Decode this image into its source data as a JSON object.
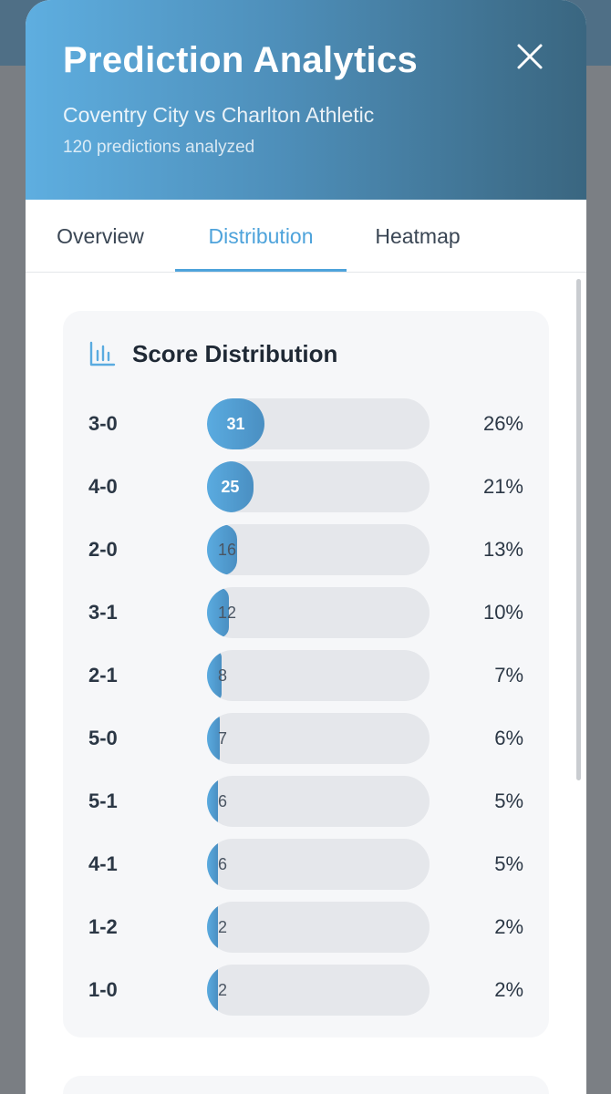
{
  "header": {
    "title": "Prediction Analytics",
    "subtitle": "Coventry City vs Charlton Athletic",
    "meta": "120 predictions analyzed",
    "close_icon": "close-icon"
  },
  "tabs": [
    {
      "label": "Overview",
      "active": false
    },
    {
      "label": "Distribution",
      "active": true
    },
    {
      "label": "Heatmap",
      "active": false
    }
  ],
  "card": {
    "icon": "bar-chart-icon",
    "title": "Score Distribution"
  },
  "colors": {
    "accent": "#4ea3db",
    "header_start": "#5eaee0",
    "header_end": "#3a6680",
    "track": "#e5e7eb"
  },
  "chart_data": {
    "type": "bar",
    "categories": [
      "3-0",
      "4-0",
      "2-0",
      "3-1",
      "2-1",
      "5-0",
      "5-1",
      "4-1",
      "1-2",
      "1-0"
    ],
    "values": [
      31,
      25,
      16,
      12,
      8,
      7,
      6,
      6,
      2,
      2
    ],
    "percentages": [
      "26%",
      "21%",
      "13%",
      "10%",
      "7%",
      "6%",
      "5%",
      "5%",
      "2%",
      "2%"
    ],
    "max": 120
  }
}
